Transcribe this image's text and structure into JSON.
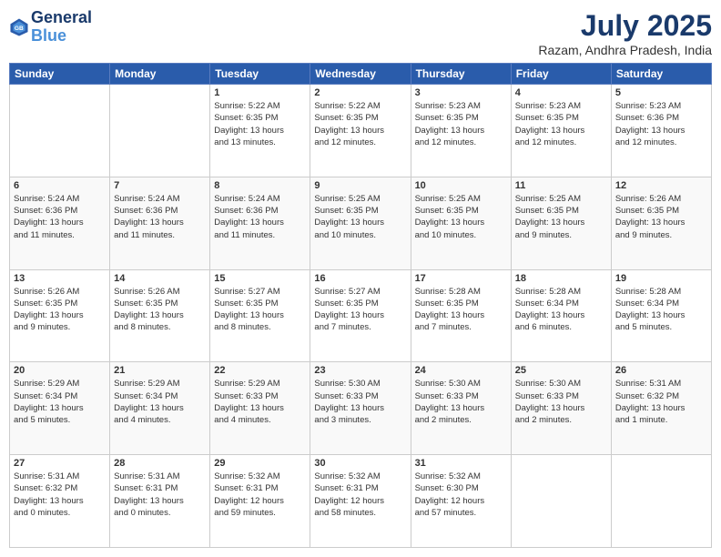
{
  "header": {
    "logo_line1": "General",
    "logo_line2": "Blue",
    "month": "July 2025",
    "location": "Razam, Andhra Pradesh, India"
  },
  "days_of_week": [
    "Sunday",
    "Monday",
    "Tuesday",
    "Wednesday",
    "Thursday",
    "Friday",
    "Saturday"
  ],
  "weeks": [
    [
      {
        "num": "",
        "info": ""
      },
      {
        "num": "",
        "info": ""
      },
      {
        "num": "1",
        "info": "Sunrise: 5:22 AM\nSunset: 6:35 PM\nDaylight: 13 hours\nand 13 minutes."
      },
      {
        "num": "2",
        "info": "Sunrise: 5:22 AM\nSunset: 6:35 PM\nDaylight: 13 hours\nand 12 minutes."
      },
      {
        "num": "3",
        "info": "Sunrise: 5:23 AM\nSunset: 6:35 PM\nDaylight: 13 hours\nand 12 minutes."
      },
      {
        "num": "4",
        "info": "Sunrise: 5:23 AM\nSunset: 6:35 PM\nDaylight: 13 hours\nand 12 minutes."
      },
      {
        "num": "5",
        "info": "Sunrise: 5:23 AM\nSunset: 6:36 PM\nDaylight: 13 hours\nand 12 minutes."
      }
    ],
    [
      {
        "num": "6",
        "info": "Sunrise: 5:24 AM\nSunset: 6:36 PM\nDaylight: 13 hours\nand 11 minutes."
      },
      {
        "num": "7",
        "info": "Sunrise: 5:24 AM\nSunset: 6:36 PM\nDaylight: 13 hours\nand 11 minutes."
      },
      {
        "num": "8",
        "info": "Sunrise: 5:24 AM\nSunset: 6:36 PM\nDaylight: 13 hours\nand 11 minutes."
      },
      {
        "num": "9",
        "info": "Sunrise: 5:25 AM\nSunset: 6:35 PM\nDaylight: 13 hours\nand 10 minutes."
      },
      {
        "num": "10",
        "info": "Sunrise: 5:25 AM\nSunset: 6:35 PM\nDaylight: 13 hours\nand 10 minutes."
      },
      {
        "num": "11",
        "info": "Sunrise: 5:25 AM\nSunset: 6:35 PM\nDaylight: 13 hours\nand 9 minutes."
      },
      {
        "num": "12",
        "info": "Sunrise: 5:26 AM\nSunset: 6:35 PM\nDaylight: 13 hours\nand 9 minutes."
      }
    ],
    [
      {
        "num": "13",
        "info": "Sunrise: 5:26 AM\nSunset: 6:35 PM\nDaylight: 13 hours\nand 9 minutes."
      },
      {
        "num": "14",
        "info": "Sunrise: 5:26 AM\nSunset: 6:35 PM\nDaylight: 13 hours\nand 8 minutes."
      },
      {
        "num": "15",
        "info": "Sunrise: 5:27 AM\nSunset: 6:35 PM\nDaylight: 13 hours\nand 8 minutes."
      },
      {
        "num": "16",
        "info": "Sunrise: 5:27 AM\nSunset: 6:35 PM\nDaylight: 13 hours\nand 7 minutes."
      },
      {
        "num": "17",
        "info": "Sunrise: 5:28 AM\nSunset: 6:35 PM\nDaylight: 13 hours\nand 7 minutes."
      },
      {
        "num": "18",
        "info": "Sunrise: 5:28 AM\nSunset: 6:34 PM\nDaylight: 13 hours\nand 6 minutes."
      },
      {
        "num": "19",
        "info": "Sunrise: 5:28 AM\nSunset: 6:34 PM\nDaylight: 13 hours\nand 5 minutes."
      }
    ],
    [
      {
        "num": "20",
        "info": "Sunrise: 5:29 AM\nSunset: 6:34 PM\nDaylight: 13 hours\nand 5 minutes."
      },
      {
        "num": "21",
        "info": "Sunrise: 5:29 AM\nSunset: 6:34 PM\nDaylight: 13 hours\nand 4 minutes."
      },
      {
        "num": "22",
        "info": "Sunrise: 5:29 AM\nSunset: 6:33 PM\nDaylight: 13 hours\nand 4 minutes."
      },
      {
        "num": "23",
        "info": "Sunrise: 5:30 AM\nSunset: 6:33 PM\nDaylight: 13 hours\nand 3 minutes."
      },
      {
        "num": "24",
        "info": "Sunrise: 5:30 AM\nSunset: 6:33 PM\nDaylight: 13 hours\nand 2 minutes."
      },
      {
        "num": "25",
        "info": "Sunrise: 5:30 AM\nSunset: 6:33 PM\nDaylight: 13 hours\nand 2 minutes."
      },
      {
        "num": "26",
        "info": "Sunrise: 5:31 AM\nSunset: 6:32 PM\nDaylight: 13 hours\nand 1 minute."
      }
    ],
    [
      {
        "num": "27",
        "info": "Sunrise: 5:31 AM\nSunset: 6:32 PM\nDaylight: 13 hours\nand 0 minutes."
      },
      {
        "num": "28",
        "info": "Sunrise: 5:31 AM\nSunset: 6:31 PM\nDaylight: 13 hours\nand 0 minutes."
      },
      {
        "num": "29",
        "info": "Sunrise: 5:32 AM\nSunset: 6:31 PM\nDaylight: 12 hours\nand 59 minutes."
      },
      {
        "num": "30",
        "info": "Sunrise: 5:32 AM\nSunset: 6:31 PM\nDaylight: 12 hours\nand 58 minutes."
      },
      {
        "num": "31",
        "info": "Sunrise: 5:32 AM\nSunset: 6:30 PM\nDaylight: 12 hours\nand 57 minutes."
      },
      {
        "num": "",
        "info": ""
      },
      {
        "num": "",
        "info": ""
      }
    ]
  ]
}
